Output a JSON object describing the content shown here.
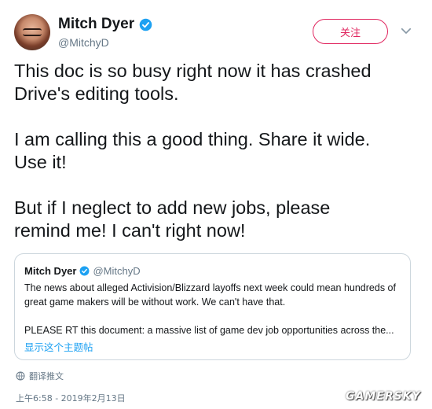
{
  "author": {
    "display_name": "Mitch Dyer",
    "handle": "@MitchyD",
    "verified_color": "#1da1f2"
  },
  "actions": {
    "follow_label": "关注"
  },
  "tweet": {
    "text": "This doc is so busy right now it has crashed\nDrive's editing tools.\n\nI am calling this a good thing. Share it wide.\nUse it!\n\nBut if I neglect to add new jobs, please\nremind me! I can't right now!"
  },
  "quoted": {
    "display_name": "Mitch Dyer",
    "handle": "@MitchyD",
    "text": "The news about alleged Activision/Blizzard layoffs next week could mean hundreds of\ngreat game makers will be without work. We can't have that.\n\nPLEASE RT this document: a massive list of game dev job opportunities across the...",
    "show_thread_label": "显示这个主题帖"
  },
  "translate_label": "翻译推文",
  "timestamp": "上午6:58 - 2019年2月13日",
  "watermark": "GAMERSKY",
  "colors": {
    "accent_blue": "#1da1f2",
    "follow_pink": "#e0245e",
    "secondary_text": "#657786"
  }
}
